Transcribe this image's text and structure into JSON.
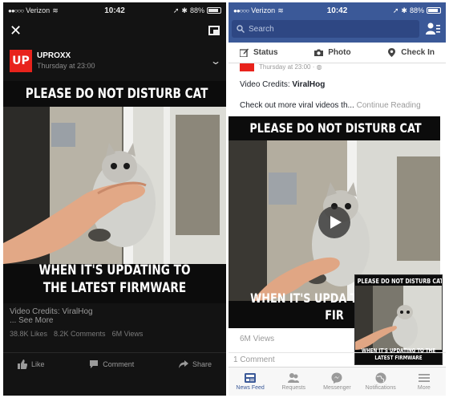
{
  "left": {
    "status": {
      "carrier": "Verizon",
      "time": "10:42",
      "battery": "88%"
    },
    "page_name": "UPROXX",
    "page_logo_text": "UP",
    "post_time": "Thursday at 23:00",
    "video": {
      "title": "PLEASE DO NOT DISTURB CAT",
      "caption": "WHEN IT'S UPDATING TO THE LATEST FIRMWARE"
    },
    "credits": "Video Credits: ViralHog",
    "see_more": "... See More",
    "stats": {
      "likes": "38.8K Likes",
      "comments": "8.2K Comments",
      "views": "6M Views"
    },
    "actions": {
      "like": "Like",
      "comment": "Comment",
      "share": "Share"
    }
  },
  "right": {
    "status": {
      "carrier": "Verizon",
      "time": "10:42",
      "battery": "88%"
    },
    "search_placeholder": "Search",
    "composer": {
      "status": "Status",
      "photo": "Photo",
      "checkin": "Check In"
    },
    "post_time": "Thursday at 23:00 · ",
    "credits_prefix": "Video Credits: ",
    "credits_name": "ViralHog",
    "more_text": "Check out more viral videos th...",
    "continue_reading": "Continue Reading",
    "video": {
      "title": "PLEASE DO NOT DISTURB CAT",
      "caption_partial": "WHEN IT'S UPDA THE LATEST FIR"
    },
    "pip_video": {
      "title": "PLEASE DO NOT DISTURB CAT",
      "caption": "WHEN IT'S UPDATING TO THE LATEST FIRMWARE"
    },
    "views": "6M Views",
    "comments": "1 Comment",
    "tabs": [
      {
        "label": "News Feed",
        "icon": "news-feed-icon"
      },
      {
        "label": "Requests",
        "icon": "requests-icon"
      },
      {
        "label": "Messenger",
        "icon": "messenger-icon"
      },
      {
        "label": "Notifications",
        "icon": "notifications-icon"
      },
      {
        "label": "More",
        "icon": "more-icon"
      }
    ],
    "colors": {
      "brand_blue": "#3b5998",
      "uproxx_red": "#e8231c"
    }
  }
}
